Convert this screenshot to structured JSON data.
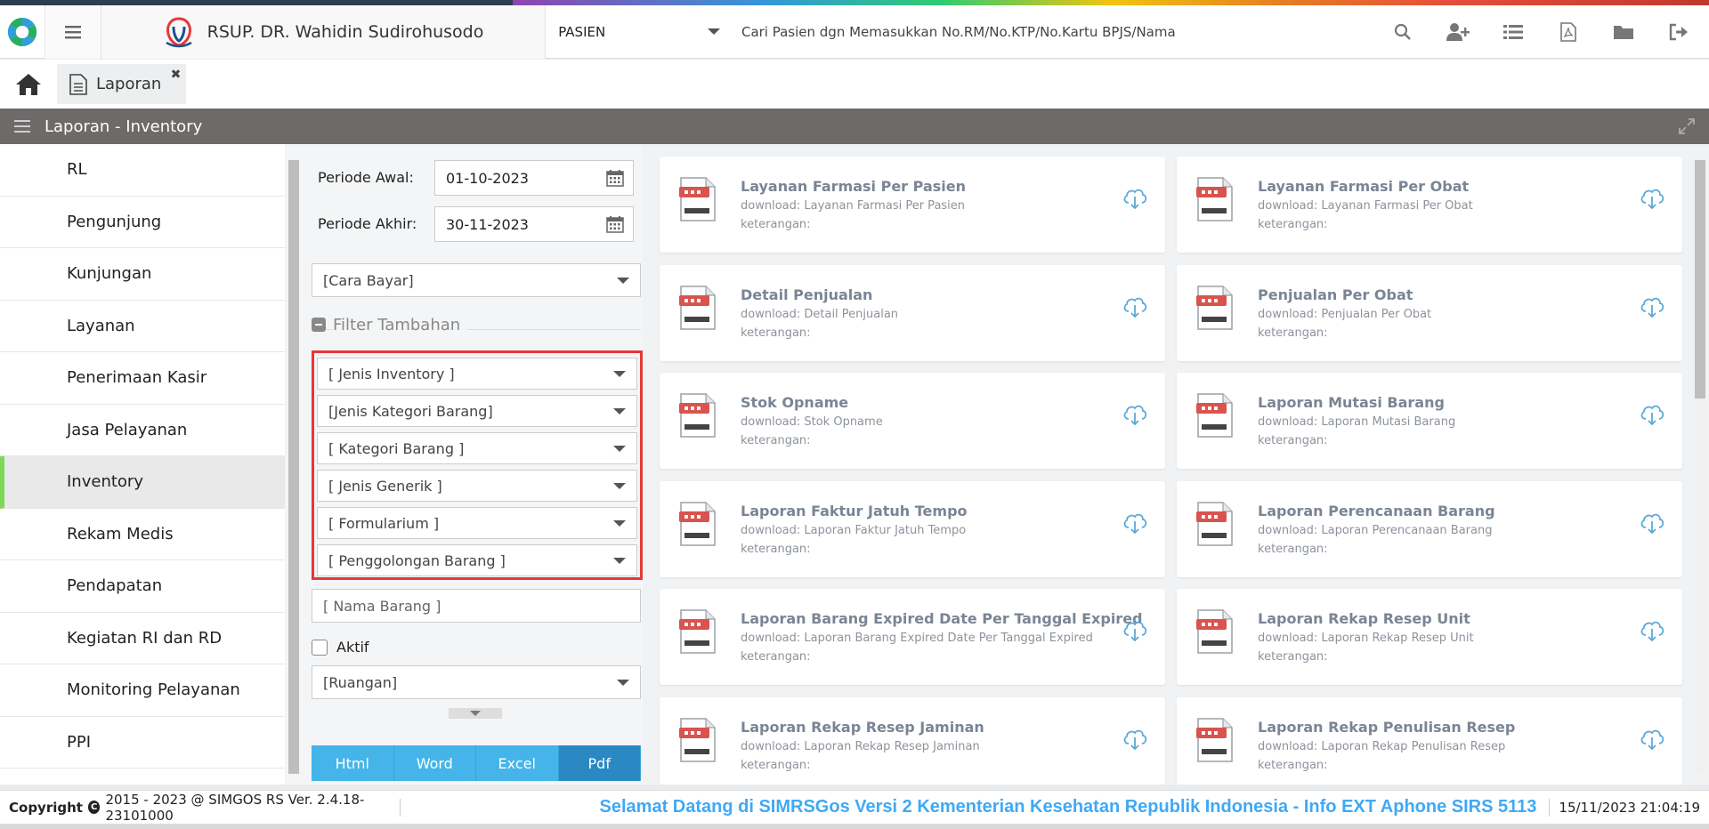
{
  "header": {
    "hospital_name": "RSUP. DR. Wahidin Sudirohusodo",
    "patient_select": "PASIEN",
    "search_placeholder": "Cari Pasien dgn Memasukkan No.RM/No.KTP/No.Kartu BPJS/Nama"
  },
  "tabs": {
    "active_tab": "Laporan"
  },
  "panel": {
    "title": "Laporan - Inventory"
  },
  "sidebar": {
    "items": [
      {
        "label": "RL"
      },
      {
        "label": "Pengunjung"
      },
      {
        "label": "Kunjungan"
      },
      {
        "label": "Layanan"
      },
      {
        "label": "Penerimaan Kasir"
      },
      {
        "label": "Jasa Pelayanan"
      },
      {
        "label": "Inventory"
      },
      {
        "label": "Rekam Medis"
      },
      {
        "label": "Pendapatan"
      },
      {
        "label": "Kegiatan RI dan RD"
      },
      {
        "label": "Monitoring Pelayanan"
      },
      {
        "label": "PPI"
      }
    ],
    "active": "Inventory"
  },
  "filters": {
    "periode_awal_label": "Periode Awal:",
    "periode_awal_value": "01-10-2023",
    "periode_akhir_label": "Periode Akhir:",
    "periode_akhir_value": "30-11-2023",
    "cara_bayar": "[Cara Bayar]",
    "filter_tambahan": "Filter Tambahan",
    "jenis_inventory": "[ Jenis Inventory ]",
    "jenis_kategori_barang": "[Jenis Kategori Barang]",
    "kategori_barang": "[ Kategori Barang ]",
    "jenis_generik": "[ Jenis Generik ]",
    "formularium": "[ Formularium ]",
    "penggolongan_barang": "[ Penggolongan Barang ]",
    "nama_barang_placeholder": "[ Nama Barang ]",
    "aktif_label": "Aktif",
    "ruangan": "[Ruangan]",
    "buttons": {
      "html": "Html",
      "word": "Word",
      "excel": "Excel",
      "pdf": "Pdf"
    }
  },
  "reports": [
    {
      "title": "Layanan Farmasi Per Pasien",
      "download": "download: Layanan Farmasi Per Pasien",
      "keterangan": "keterangan:"
    },
    {
      "title": "Layanan Farmasi Per Obat",
      "download": "download: Layanan Farmasi Per Obat",
      "keterangan": "keterangan:"
    },
    {
      "title": "Detail Penjualan",
      "download": "download: Detail Penjualan",
      "keterangan": "keterangan:"
    },
    {
      "title": "Penjualan Per Obat",
      "download": "download: Penjualan Per Obat",
      "keterangan": "keterangan:"
    },
    {
      "title": "Stok Opname",
      "download": "download: Stok Opname",
      "keterangan": "keterangan:"
    },
    {
      "title": "Laporan Mutasi Barang",
      "download": "download: Laporan Mutasi Barang",
      "keterangan": "keterangan:"
    },
    {
      "title": "Laporan Faktur Jatuh Tempo",
      "download": "download: Laporan Faktur Jatuh Tempo",
      "keterangan": "keterangan:"
    },
    {
      "title": "Laporan Perencanaan Barang",
      "download": "download: Laporan Perencanaan Barang",
      "keterangan": "keterangan:"
    },
    {
      "title": "Laporan Barang Expired Date Per Tanggal Expired",
      "download": "download: Laporan Barang Expired Date Per Tanggal Expired",
      "keterangan": "keterangan:"
    },
    {
      "title": "Laporan Rekap Resep Unit",
      "download": "download: Laporan Rekap Resep Unit",
      "keterangan": "keterangan:"
    },
    {
      "title": "Laporan Rekap Resep Jaminan",
      "download": "download: Laporan Rekap Resep Jaminan",
      "keterangan": "keterangan:"
    },
    {
      "title": "Laporan Rekap Penulisan Resep",
      "download": "download: Laporan Rekap Penulisan Resep",
      "keterangan": "keterangan:"
    }
  ],
  "footer": {
    "copyright_label": "Copyright",
    "copyright_text": "2015 - 2023 @ SIMGOS RS Ver. 2.4.18-23101000",
    "marquee": "Selamat Datang di SIMRSGos Versi 2 Kementerian Kesehatan Republik Indonesia - Info EXT Aphone SIRS 5113",
    "datetime": "15/11/2023 21:04:19"
  },
  "colors": {
    "accent_blue": "#45b5e9",
    "active_pdf": "#2a89c3",
    "highlight_red": "#e53935",
    "active_sidebar": "#7ed957",
    "panel_bar": "#6d6a69"
  }
}
